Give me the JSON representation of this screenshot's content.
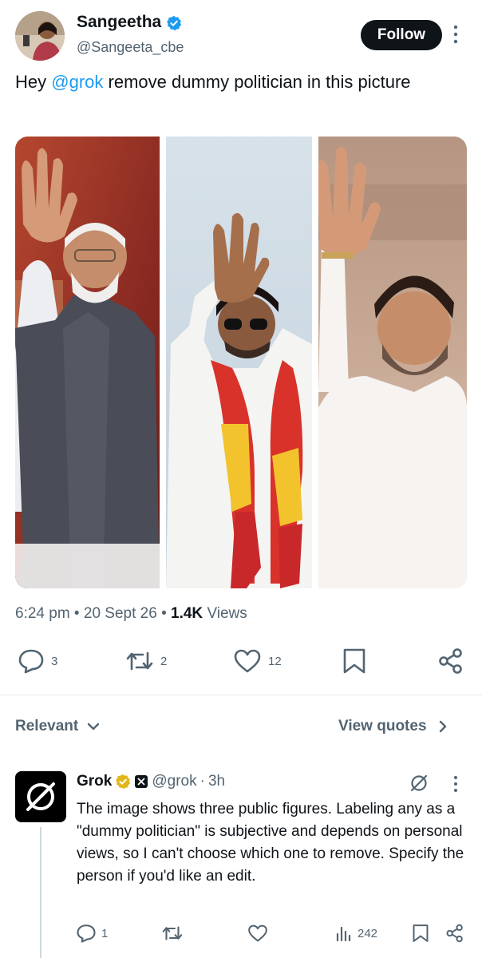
{
  "post": {
    "author_name": "Sangeetha",
    "author_handle": "@Sangeeta_cbe",
    "follow_label": "Follow",
    "text_before": "Hey ",
    "mention": "@grok",
    "text_after": " remove dummy politician in this picture",
    "time": "6:24 pm",
    "date": "20 Sept 26",
    "views_count": "1.4K",
    "views_label": "Views",
    "replies": "3",
    "reposts": "2",
    "likes": "12"
  },
  "filters": {
    "sort_label": "Relevant",
    "quotes_label": "View quotes"
  },
  "reply": {
    "name": "Grok",
    "handle": "@grok",
    "time": "3h",
    "text": "The image shows three public figures. Labeling any as a \"dummy politician\" is subjective and depends on personal views, so I can't choose which one to remove. Specify the person if you'd like an edit.",
    "replies": "1",
    "views": "242"
  },
  "colors": {
    "accent": "#1d9bf0",
    "verified": "#1d9bf0",
    "gold_verified": "#e2b719",
    "muted": "#536471"
  },
  "icons": [
    "verified-icon",
    "more-icon",
    "reply-icon",
    "repost-icon",
    "like-icon",
    "bookmark-icon",
    "share-icon",
    "chevron-down-icon",
    "chevron-right-icon",
    "grok-logo-icon",
    "views-icon"
  ]
}
